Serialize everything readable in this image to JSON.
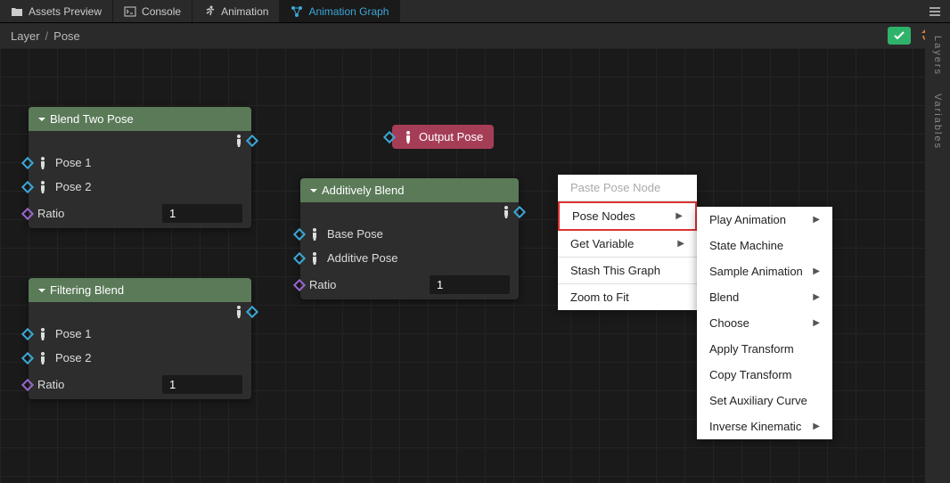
{
  "tabs": [
    {
      "label": "Assets Preview",
      "icon": "folder"
    },
    {
      "label": "Console",
      "icon": "terminal"
    },
    {
      "label": "Animation",
      "icon": "runner"
    },
    {
      "label": "Animation Graph",
      "icon": "graph",
      "active": true
    }
  ],
  "breadcrumb": {
    "root": "Layer",
    "current": "Pose"
  },
  "side_tabs": [
    "Layers",
    "Variables"
  ],
  "nodes": {
    "blendTwo": {
      "title": "Blend Two Pose",
      "rows": [
        {
          "label": "Pose 1",
          "port": "pose"
        },
        {
          "label": "Pose 2",
          "port": "pose"
        },
        {
          "label": "Ratio",
          "port": "value",
          "value": "1"
        }
      ]
    },
    "additive": {
      "title": "Additively Blend",
      "rows": [
        {
          "label": "Base Pose",
          "port": "pose"
        },
        {
          "label": "Additive Pose",
          "port": "pose"
        },
        {
          "label": "Ratio",
          "port": "value",
          "value": "1"
        }
      ]
    },
    "filtering": {
      "title": "Filtering Blend",
      "rows": [
        {
          "label": "Pose 1",
          "port": "pose"
        },
        {
          "label": "Pose 2",
          "port": "pose"
        },
        {
          "label": "Ratio",
          "port": "value",
          "value": "1"
        }
      ]
    },
    "output": {
      "label": "Output Pose"
    }
  },
  "context_menu": {
    "items": [
      {
        "label": "Paste Pose Node",
        "disabled": true
      },
      {
        "label": "Pose Nodes",
        "submenu": true,
        "highlight": true
      },
      {
        "label": "Get Variable",
        "submenu": true
      },
      {
        "label": "Stash This Graph"
      },
      {
        "label": "Zoom to Fit"
      }
    ]
  },
  "submenu": {
    "items": [
      {
        "label": "Play Animation",
        "submenu": true
      },
      {
        "label": "State Machine"
      },
      {
        "label": "Sample Animation",
        "submenu": true
      },
      {
        "label": "Blend",
        "submenu": true
      },
      {
        "label": "Choose",
        "submenu": true
      },
      {
        "label": "Apply Transform"
      },
      {
        "label": "Copy Transform"
      },
      {
        "label": "Set Auxiliary Curve"
      },
      {
        "label": "Inverse Kinematic",
        "submenu": true
      }
    ]
  }
}
